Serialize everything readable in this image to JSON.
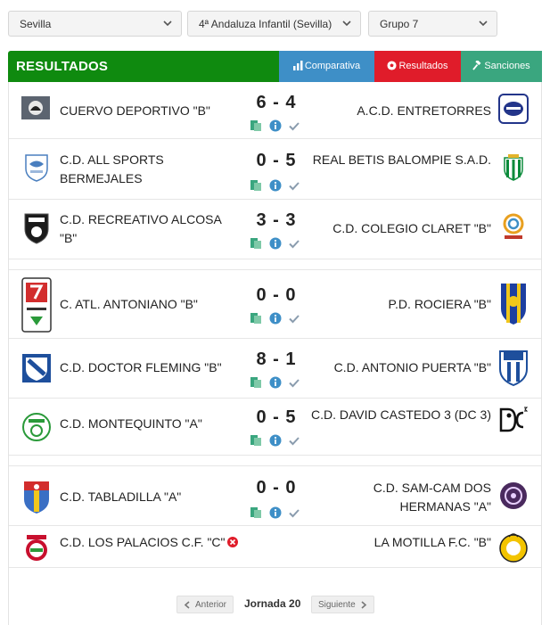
{
  "filters": {
    "region": "Sevilla",
    "competition": "4ª Andaluza Infantil (Sevilla)",
    "group": "Grupo 7"
  },
  "header": {
    "title": "RESULTADOS",
    "tabs": {
      "comparativa": "Comparativa",
      "resultados": "Resultados",
      "sanciones": "Sanciones"
    },
    "colors": {
      "header": "#0f8a0f",
      "comparativa": "#3e8fc7",
      "resultados": "#e01c2a",
      "sanciones": "#3aa67f"
    }
  },
  "matches": [
    {
      "home": "CUERVO DEPORTIVO \"B\"",
      "score": "6 - 4",
      "away": "A.C.D. ENTRETORRES"
    },
    {
      "home": "C.D. ALL SPORTS BERMEJALES",
      "score": "0 - 5",
      "away": "REAL BETIS BALOMPIE S.A.D."
    },
    {
      "home": "C.D. RECREATIVO ALCOSA \"B\"",
      "score": "3 - 3",
      "away": "C.D. COLEGIO CLARET \"B\""
    },
    {
      "home": "C. ATL. ANTONIANO \"B\"",
      "score": "0 - 0",
      "away": "P.D. ROCIERA \"B\""
    },
    {
      "home": "C.D. DOCTOR FLEMING \"B\"",
      "score": "8 - 1",
      "away": "C.D. ANTONIO PUERTA \"B\""
    },
    {
      "home": "C.D. MONTEQUINTO \"A\"",
      "score": "0 - 5",
      "away": "C.D. DAVID CASTEDO 3 (DC 3)"
    },
    {
      "home": "C.D. TABLADILLA \"A\"",
      "score": "0 - 0",
      "away": "C.D. SAM-CAM DOS HERMANAS \"A\""
    },
    {
      "home": "C.D. LOS PALACIOS C.F. \"C\"",
      "score": "",
      "away": "LA MOTILLA F.C. \"B\""
    }
  ],
  "pagination": {
    "prev": "Anterior",
    "current": "Jornada 20",
    "next": "Siguiente"
  }
}
